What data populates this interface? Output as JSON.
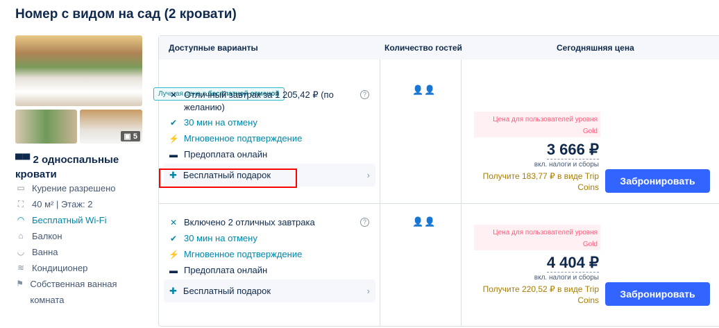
{
  "room": {
    "title": "Номер с видом на сад (2 кровати)",
    "photo_count": "5",
    "beds": "2 односпальные кровати",
    "amenities": [
      {
        "icon": "smoking-icon",
        "label": "Курение разрешено"
      },
      {
        "icon": "area-icon",
        "label": "40 м² | Этаж: 2"
      },
      {
        "icon": "wifi-icon",
        "label": "Бесплатный Wi-Fi"
      },
      {
        "icon": "balcony-icon",
        "label": "Балкон"
      },
      {
        "icon": "bath-icon",
        "label": "Ванна"
      },
      {
        "icon": "ac-icon",
        "label": "Кондиционер"
      },
      {
        "icon": "shower-icon",
        "label": "Собственная ванная комната"
      }
    ]
  },
  "table": {
    "headers": [
      "Доступные варианты",
      "Количество гостей",
      "Сегодняшняя цена"
    ],
    "badge_prefix": "Лучшая цена с ",
    "badge_bold": "бесплатной отменой",
    "rows": [
      {
        "meal": "Отличный завтрак за 1 205,42 ₽ (по желанию)",
        "cancel": "30 мин на отмену",
        "confirm": "Мгновенное подтверждение",
        "prepay": "Предоплата онлайн",
        "gift": "Бесплатный подарок",
        "guests": "2",
        "gold_line1": "Цена для пользователей уровня",
        "gold_line2": "Gold",
        "price": "3 666 ₽",
        "tax": "вкл. налоги и сборы",
        "coins": "Получите 183,77 ₽ в виде Trip Coins",
        "book": "Забронировать"
      },
      {
        "meal": "Включено 2 отличных завтрака",
        "cancel": "30 мин на отмену",
        "confirm": "Мгновенное подтверждение",
        "prepay": "Предоплата онлайн",
        "gift": "Бесплатный подарок",
        "guests": "2",
        "gold_line1": "Цена для пользователей уровня",
        "gold_line2": "Gold",
        "price": "4 404 ₽",
        "tax": "вкл. налоги и сборы",
        "coins": "Получите 220,52 ₽ в виде Trip Coins",
        "book": "Забронировать"
      }
    ]
  },
  "colors": {
    "accent": "#3264ff",
    "teal": "#0086a8",
    "highlight": "#ff0000"
  }
}
